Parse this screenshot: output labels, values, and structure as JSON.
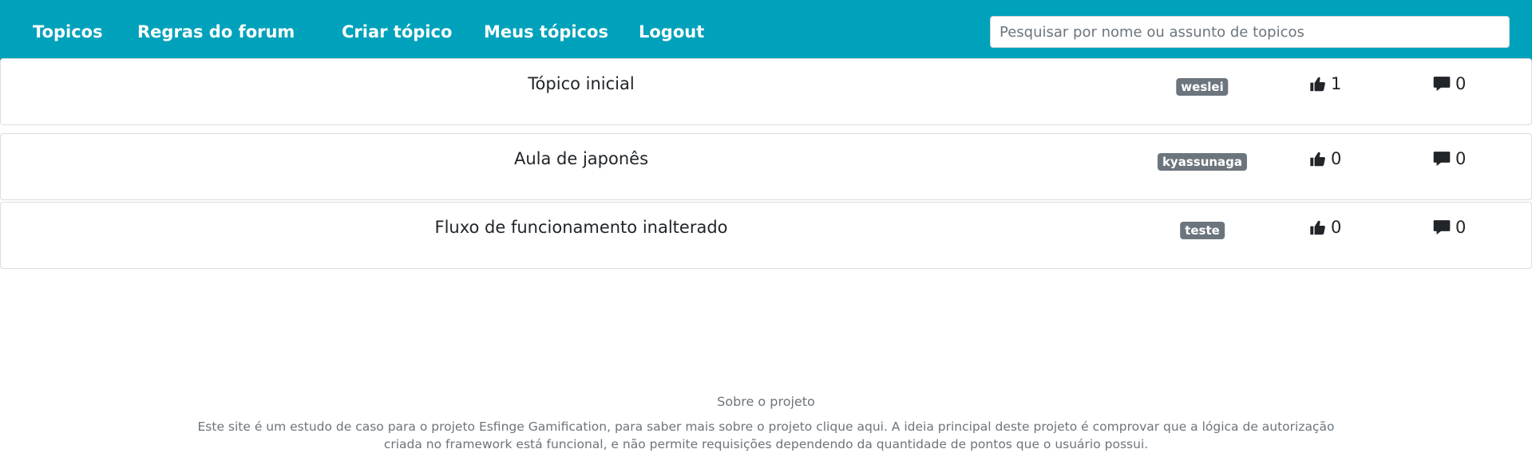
{
  "nav": {
    "items": [
      {
        "label": "Topicos"
      },
      {
        "label": "Regras do forum"
      },
      {
        "label": "Criar tópico"
      },
      {
        "label": "Meus tópicos"
      },
      {
        "label": "Logout"
      }
    ],
    "search_placeholder": "Pesquisar por nome ou assunto de topicos",
    "background_color": "#00a2bb"
  },
  "topics": [
    {
      "title": "Tópico inicial",
      "author": "weslei",
      "likes": "1",
      "comments": "0"
    },
    {
      "title": "Aula de japonês",
      "author": "kyassunaga",
      "likes": "0",
      "comments": "0"
    },
    {
      "title": "Fluxo de funcionamento inalterado",
      "author": "teste",
      "likes": "0",
      "comments": "0"
    }
  ],
  "icons": {
    "likes": "thumbs-up-icon",
    "comments": "comment-icon"
  },
  "badge_color": "#6c757d",
  "footer": {
    "title": "Sobre o projeto",
    "line1": "Este site é um estudo de caso para o projeto Esfinge Gamification, para saber mais sobre o projeto clique aqui. A ideia principal deste projeto é comprovar que a lógica de autorização",
    "line2": "criada no framework está funcional, e não permite requisições dependendo da quantidade de pontos que o usuário possui."
  }
}
